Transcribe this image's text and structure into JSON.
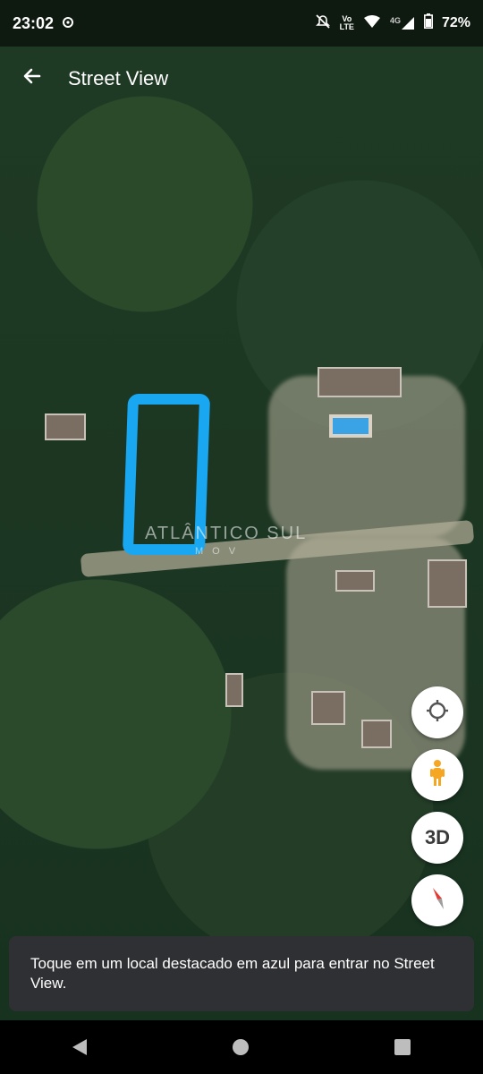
{
  "status_bar": {
    "time": "23:02",
    "left_icon": "gear-sync-icon",
    "right_icons": [
      "silent-icon",
      "volte-icon",
      "wifi-icon",
      "signal-4g-icon",
      "battery-icon"
    ],
    "network_label": "4G",
    "battery_percent": "72%"
  },
  "app_bar": {
    "back_icon": "arrow-left-icon",
    "title": "Street View"
  },
  "map": {
    "highlight_color": "#1aa7f2",
    "watermark_main": "ATLÂNTICO SUL",
    "watermark_sub": "MOV"
  },
  "controls": {
    "locate_icon": "my-location-icon",
    "pegman_icon": "pegman-icon",
    "three_d_label": "3D",
    "compass_icon": "compass-icon"
  },
  "toast": {
    "message": "Toque em um local destacado em azul para entrar no Street View."
  },
  "nav_bar": {
    "icons": [
      "nav-back-icon",
      "nav-home-icon",
      "nav-recents-icon"
    ]
  }
}
